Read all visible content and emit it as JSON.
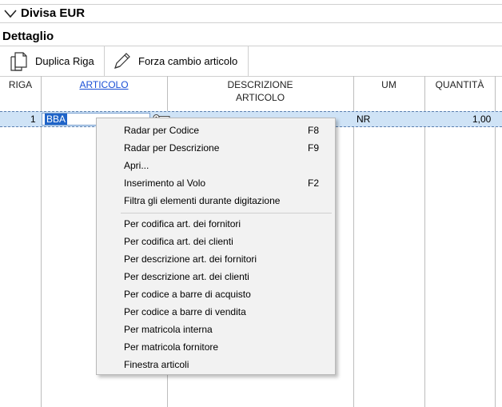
{
  "section": {
    "title": "Divisa EUR"
  },
  "detail_title": "Dettaglio",
  "toolbar": {
    "duplicate_label": "Duplica Riga",
    "force_change_label": "Forza cambio articolo"
  },
  "grid": {
    "headers": {
      "riga": "RIGA",
      "articolo": "ARTICOLO",
      "descrizione_1": "DESCRIZIONE",
      "descrizione_2": "ARTICOLO",
      "um": "UM",
      "quantita": "QUANTITÀ"
    },
    "row": {
      "riga": "1",
      "articolo": "BBA",
      "um": "NR",
      "quantita": "1,00"
    }
  },
  "context_menu": {
    "items_top": [
      {
        "label": "Radar per Codice",
        "shortcut": "F8"
      },
      {
        "label": "Radar per Descrizione",
        "shortcut": "F9"
      },
      {
        "label": "Apri...",
        "shortcut": ""
      },
      {
        "label": "Inserimento al Volo",
        "shortcut": "F2"
      },
      {
        "label": "Filtra gli elementi durante digitazione",
        "shortcut": ""
      }
    ],
    "items_bottom": [
      {
        "label": "Per codifica art. dei fornitori"
      },
      {
        "label": "Per codifica art. dei clienti"
      },
      {
        "label": "Per descrizione art. dei fornitori"
      },
      {
        "label": "Per descrizione art. dei clienti"
      },
      {
        "label": "Per codice a barre di acquisto"
      },
      {
        "label": "Per codice a barre di vendita"
      },
      {
        "label": "Per matricola interna"
      },
      {
        "label": "Per matricola fornitore"
      },
      {
        "label": "Finestra articoli"
      }
    ]
  }
}
